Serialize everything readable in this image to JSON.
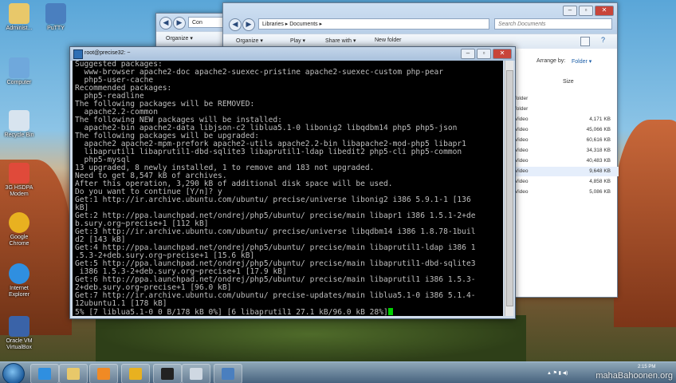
{
  "desktop_icons": [
    {
      "label": "Administ...",
      "icon": "user-folder-icon",
      "color": "#e8c86a"
    },
    {
      "label": "PuTTY",
      "icon": "putty-icon",
      "color": "#4a7fbf"
    },
    {
      "label": "Computer",
      "icon": "computer-icon",
      "color": "#6fa8dc"
    },
    {
      "label": "Recycle Bin",
      "icon": "recycle-bin-icon",
      "color": "#d8e4ef"
    },
    {
      "label": "3G HSDPA Modem",
      "icon": "modem-icon",
      "color": "#e04a3a"
    },
    {
      "label": "Google Chrome",
      "icon": "chrome-icon",
      "color": "#e8b120"
    },
    {
      "label": "Internet Explorer",
      "icon": "ie-icon",
      "color": "#2f8fe0"
    },
    {
      "label": "Oracle VM VirtualBox",
      "icon": "virtualbox-icon",
      "color": "#3a63a8"
    }
  ],
  "explorer_back": {
    "address": "Con",
    "organize_label": "Organize ▾"
  },
  "explorer_front": {
    "address": "Libraries ▸ Documents ▸",
    "search_placeholder": "Search Documents",
    "organize_label": "Organize ▾",
    "play_label": "Play ▾",
    "share_label": "Share with ▾",
    "new_folder_label": "New folder",
    "arrange_label": "Arrange by:",
    "arrange_value": "Folder ▾",
    "size_header": "Size",
    "rows": [
      {
        "type": "folder",
        "size": ""
      },
      {
        "type": "folder",
        "size": ""
      },
      {
        "type": "Video",
        "size": "4,171 KB"
      },
      {
        "type": "Video",
        "size": "45,066 KB"
      },
      {
        "type": "Video",
        "size": "60,616 KB"
      },
      {
        "type": "Video",
        "size": "34,318 KB"
      },
      {
        "type": "Video",
        "size": "40,483 KB"
      },
      {
        "type": "Video",
        "size": "9,648 KB"
      },
      {
        "type": "Video",
        "size": "4,858 KB"
      },
      {
        "type": "Video",
        "size": "5,086 KB"
      }
    ]
  },
  "putty": {
    "title": "root@precise32: ~",
    "lines": [
      "Suggested packages:",
      "  www-browser apache2-doc apache2-suexec-pristine apache2-suexec-custom php-pear",
      "  php5-user-cache",
      "Recommended packages:",
      "  php5-readline",
      "The following packages will be REMOVED:",
      "  apache2.2-common",
      "The following NEW packages will be installed:",
      "  apache2-bin apache2-data libjson-c2 liblua5.1-0 libonig2 libqdbm14 php5 php5-json",
      "The following packages will be upgraded:",
      "  apache2 apache2-mpm-prefork apache2-utils apache2.2-bin libapache2-mod-php5 libapr1",
      "  libaprutil1 libaprutil1-dbd-sqlite3 libaprutil1-ldap libedit2 php5-cli php5-common",
      "  php5-mysql",
      "13 upgraded, 8 newly installed, 1 to remove and 183 not upgraded.",
      "Need to get 8,547 kB of archives.",
      "After this operation, 3,290 kB of additional disk space will be used.",
      "Do you want to continue [Y/n]? y",
      "Get:1 http://ir.archive.ubuntu.com/ubuntu/ precise/universe libonig2 i386 5.9.1-1 [136",
      "kB]",
      "Get:2 http://ppa.launchpad.net/ondrej/php5/ubuntu/ precise/main libapr1 i386 1.5.1-2+de",
      "b.sury.org~precise+1 [112 kB]",
      "Get:3 http://ir.archive.ubuntu.com/ubuntu/ precise/universe libqdbm14 i386 1.8.78-1buil",
      "d2 [143 kB]",
      "Get:4 http://ppa.launchpad.net/ondrej/php5/ubuntu/ precise/main libaprutil1-ldap i386 1",
      ".5.3-2+deb.sury.org~precise+1 [15.6 kB]",
      "Get:5 http://ppa.launchpad.net/ondrej/php5/ubuntu/ precise/main libaprutil1-dbd-sqlite3",
      " i386 1.5.3-2+deb.sury.org~precise+1 [17.9 kB]",
      "Get:6 http://ppa.launchpad.net/ondrej/php5/ubuntu/ precise/main libaprutil1 i386 1.5.3-",
      "2+deb.sury.org~precise+1 [96.0 kB]",
      "Get:7 http://ir.archive.ubuntu.com/ubuntu/ precise-updates/main liblua5.1-0 i386 5.1.4-",
      "12ubuntu1.1 [178 kB]"
    ],
    "progress_line": "5% [7 liblua5.1-0 0 B/178 kB 0%] [6 libaprutil1 27.1 kB/96.0 kB 28%]"
  },
  "taskbar": {
    "apps": [
      {
        "icon": "ie-icon",
        "color": "#2f8fe0"
      },
      {
        "icon": "explorer-folder-icon",
        "color": "#e8c86a"
      },
      {
        "icon": "media-player-icon",
        "color": "#f08a24"
      },
      {
        "icon": "chrome-icon",
        "color": "#e8b120"
      },
      {
        "icon": "cmd-icon",
        "color": "#222222"
      },
      {
        "icon": "window-icon",
        "color": "#cfd8e2"
      },
      {
        "icon": "putty-icon",
        "color": "#4a7fbf"
      }
    ],
    "clock_time": "2:15 PM",
    "watermark": "mahaBahoonen.org"
  }
}
